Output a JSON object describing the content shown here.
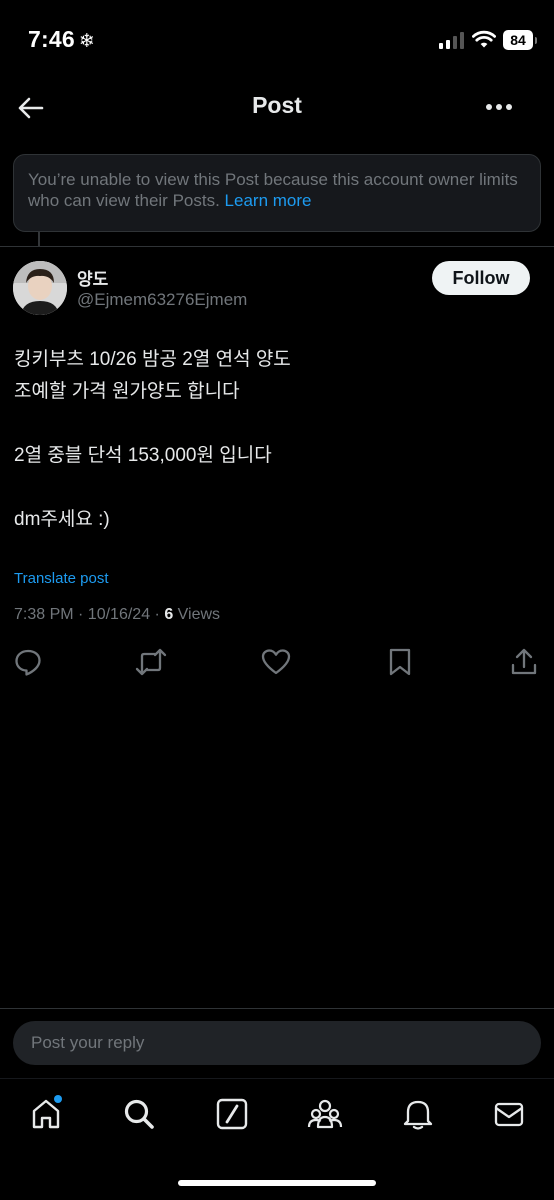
{
  "status_bar": {
    "time": "7:46",
    "time_icon": "❄",
    "battery": "84"
  },
  "header": {
    "title": "Post"
  },
  "notice": {
    "text": "You’re unable to view this Post because this account owner limits who can view their Posts.",
    "link": "Learn more"
  },
  "author": {
    "name": "양도",
    "handle": "@Ejmem63276Ejmem",
    "follow_label": "Follow"
  },
  "post": {
    "lines": [
      "킹키부츠 10/26 밤공 2열 연석 양도",
      "조예할 가격 원가양도 합니다",
      "",
      "2열 중블 단석 153,000원 입니다",
      "",
      "dm주세요 :)"
    ],
    "translate_label": "Translate post",
    "timestamp": "7:38 PM · 10/16/24 · ",
    "views_count": "6",
    "views_label": " Views"
  },
  "reply": {
    "placeholder": "Post your reply"
  },
  "icons": {
    "back": "arrow-left-icon",
    "more": "more-horizontal-icon",
    "reply": "reply-icon",
    "repost": "repost-icon",
    "like": "heart-icon",
    "bookmark": "bookmark-icon",
    "share": "share-icon",
    "home": "home-icon",
    "search": "search-icon",
    "grok": "grok-icon",
    "communities": "communities-icon",
    "notifications": "bell-icon",
    "messages": "mail-icon"
  },
  "colors": {
    "accent": "#1d9bf0",
    "background": "#000000",
    "muted": "#71767b"
  }
}
